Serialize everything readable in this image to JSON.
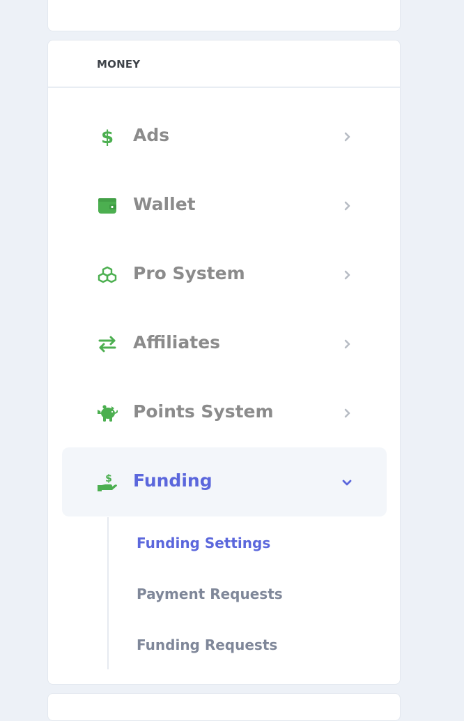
{
  "section": {
    "title": "MONEY"
  },
  "menu": {
    "items": [
      {
        "label": "Ads",
        "icon": "dollar-icon",
        "expanded": false
      },
      {
        "label": "Wallet",
        "icon": "wallet-icon",
        "expanded": false
      },
      {
        "label": "Pro System",
        "icon": "cubes-icon",
        "expanded": false
      },
      {
        "label": "Affiliates",
        "icon": "exchange-arrows-icon",
        "expanded": false
      },
      {
        "label": "Points System",
        "icon": "piggy-bank-icon",
        "expanded": false
      },
      {
        "label": "Funding",
        "icon": "hand-holding-dollar-icon",
        "expanded": true
      }
    ],
    "submenu": [
      {
        "label": "Funding Settings",
        "active": true
      },
      {
        "label": "Payment Requests",
        "active": false
      },
      {
        "label": "Funding Requests",
        "active": false
      }
    ]
  },
  "colors": {
    "icon_green": "#4caf50",
    "active_blue": "#5b67dc",
    "label_gray": "#8b8b8b",
    "sub_label_gray": "#7f8799",
    "page_background": "#edf1f7",
    "active_background": "#f3f6fa"
  }
}
